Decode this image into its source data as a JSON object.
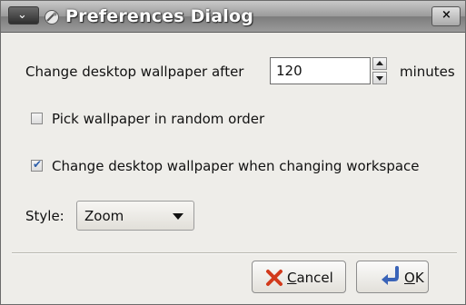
{
  "window": {
    "title": "Preferences Dialog",
    "close_label": "×",
    "menu_label": "⌄"
  },
  "interval": {
    "label": "Change desktop wallpaper after",
    "value": "120",
    "unit": "minutes"
  },
  "random": {
    "label": "Pick wallpaper in random order",
    "checked": false
  },
  "workspace": {
    "label": "Change desktop wallpaper when changing workspace",
    "checked": true,
    "mark": "✔"
  },
  "style": {
    "label": "Style:",
    "value": "Zoom"
  },
  "buttons": {
    "cancel_mnemonic": "C",
    "cancel_rest": "ancel",
    "ok_mnemonic": "O",
    "ok_rest": "K"
  },
  "colors": {
    "accent": "#2d5faa",
    "cancel_icon": "#d23a1c",
    "ok_icon": "#3a64b8"
  }
}
